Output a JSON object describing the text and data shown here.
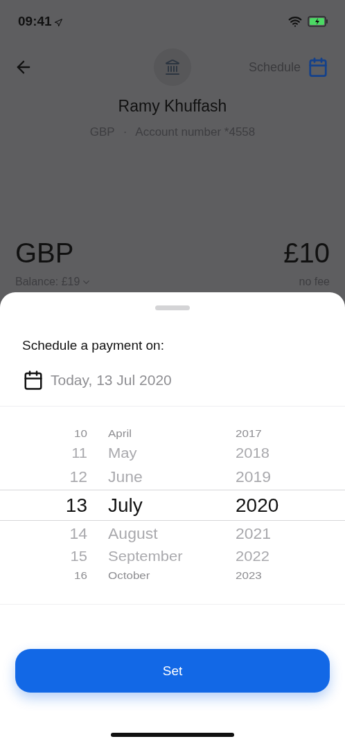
{
  "status_bar": {
    "time": "09:41"
  },
  "header": {
    "schedule_label": "Schedule"
  },
  "recipient": {
    "name": "Ramy Khuffash",
    "currency": "GBP",
    "separator": "·",
    "account": "Account number *4558"
  },
  "amount": {
    "currency": "GBP",
    "value": "£10",
    "balance": "Balance: £19",
    "fee": "no fee"
  },
  "sheet": {
    "title": "Schedule a payment on:",
    "date": "Today, 13 Jul 2020",
    "picker_rows": [
      {
        "day": "10",
        "month": "April",
        "year": "2017",
        "selected": false
      },
      {
        "day": "11",
        "month": "May",
        "year": "2018",
        "selected": false
      },
      {
        "day": "12",
        "month": "June",
        "year": "2019",
        "selected": false
      },
      {
        "day": "13",
        "month": "July",
        "year": "2020",
        "selected": true
      },
      {
        "day": "14",
        "month": "August",
        "year": "2021",
        "selected": false
      },
      {
        "day": "15",
        "month": "September",
        "year": "2022",
        "selected": false
      },
      {
        "day": "16",
        "month": "October",
        "year": "2023",
        "selected": false
      }
    ],
    "button": "Set"
  }
}
